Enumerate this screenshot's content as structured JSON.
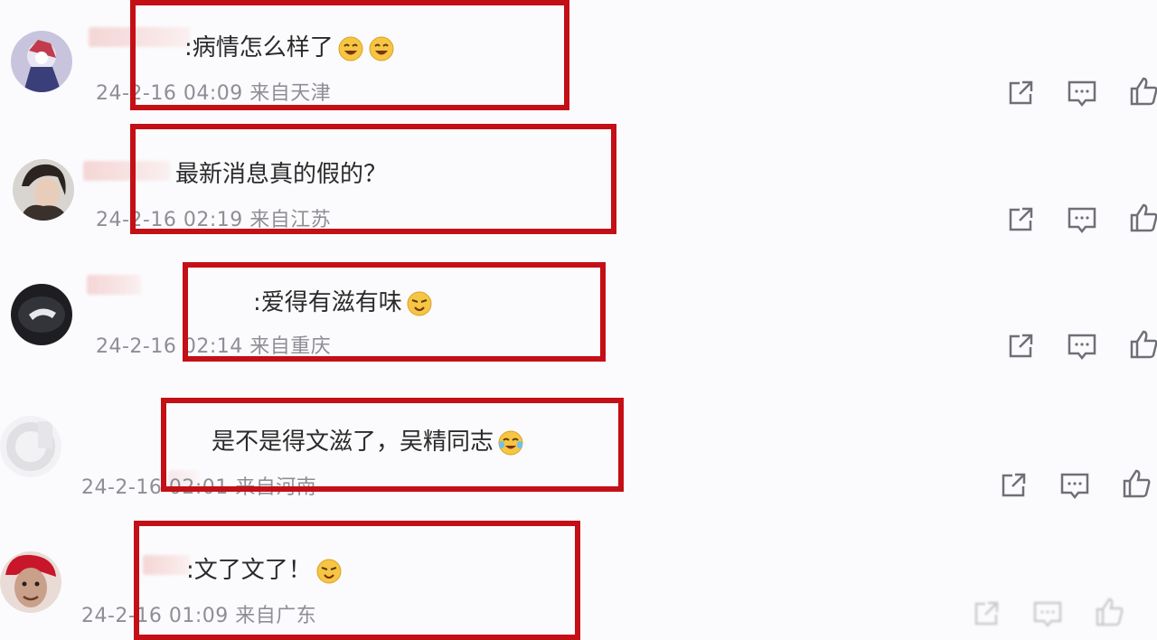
{
  "comments": [
    {
      "text": ":病情怎么样了",
      "emoji": [
        "grin-emoji",
        "grin-emoji"
      ],
      "date": "24-2-16 04:09",
      "location": "来自天津"
    },
    {
      "text": "最新消息真的假的？",
      "emoji": [],
      "date": "24-2-16 02:19",
      "location": "来自江苏"
    },
    {
      "text": ":爱得有滋有味",
      "emoji": [
        "wink-emoji"
      ],
      "date": "24-2-16 02:14",
      "location": "来自重庆"
    },
    {
      "text": "是不是得文滋了，吴精同志",
      "emoji": [
        "cry-laugh-emoji"
      ],
      "date": "24-2-16 02:01",
      "location": "来自河南"
    },
    {
      "text": ":文了文了！",
      "emoji": [
        "wink-emoji"
      ],
      "date": "24-2-16 01:09",
      "location": "来自广东"
    }
  ],
  "action_icons": [
    "share-icon",
    "comment-icon",
    "like-icon"
  ],
  "colors": {
    "highlight_box": "#c40f16",
    "meta_text": "#8e8e96",
    "icon_stroke": "#6f6f78"
  }
}
